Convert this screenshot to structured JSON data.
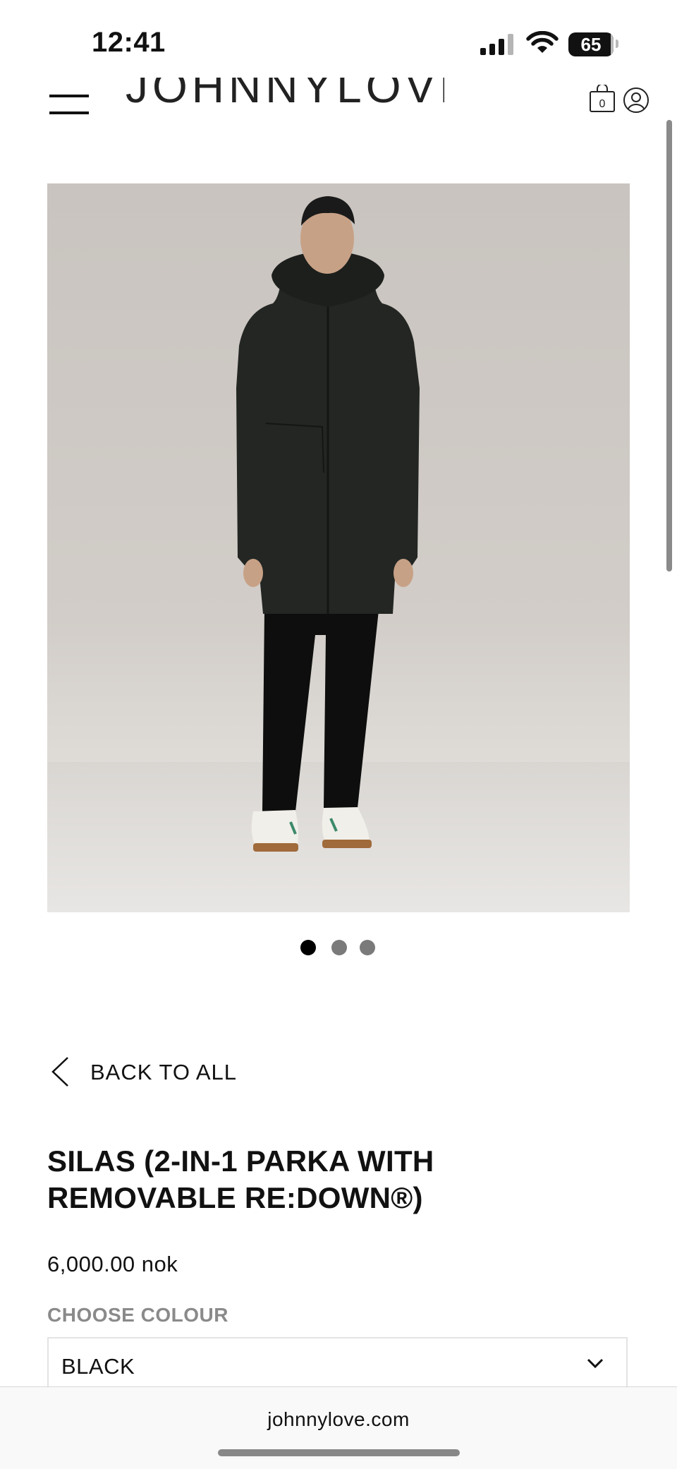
{
  "status_bar": {
    "time": "12:41",
    "battery": "65",
    "icons": [
      "signal-icon",
      "wifi-icon",
      "battery-icon"
    ]
  },
  "header": {
    "logo": "JOHNNYLOVE",
    "icons": [
      "menu-icon",
      "bag-icon",
      "account-icon"
    ],
    "bag_count": "0"
  },
  "gallery": {
    "image": "model-in-black-parka",
    "slide_count": 3,
    "active_slide": 1
  },
  "product": {
    "back_label": "BACK TO ALL",
    "title_line1": "SILAS (2-IN-1 PARKA WITH",
    "title_line2": "REMOVABLE RE:DOWN®)",
    "price": "6,000.00 nok",
    "colour_label": "CHOOSE COLOUR",
    "colour_value": "BLACK"
  },
  "browser": {
    "url": "johnnylove.com"
  },
  "colors": {
    "text": "#111111",
    "muted_label": "#8a8a8a",
    "image_bg": "#cdc8c3",
    "coat": "#232623",
    "dot_active": "#000000",
    "dot_inactive": "#7a7a7a"
  }
}
